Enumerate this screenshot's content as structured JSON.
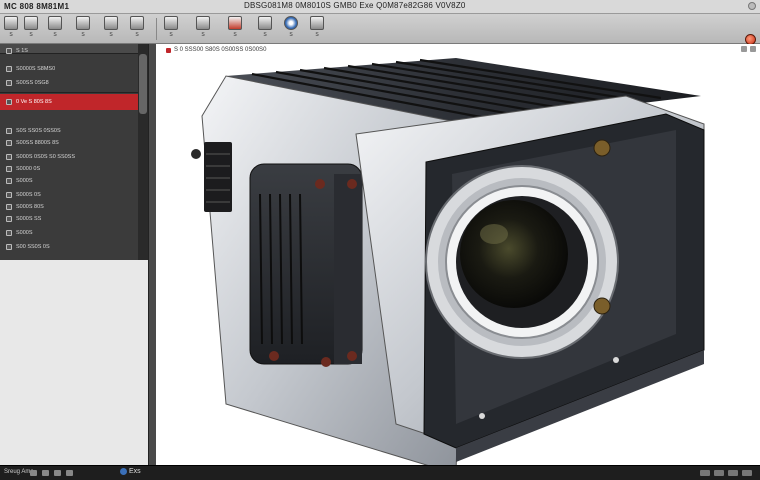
{
  "app": {
    "title": "MC 808 8M81M1",
    "document_title": "DBSG081M8 0M8010S  GMB0 Exe   Q0M87e82G86 V0V8Z0"
  },
  "ribbon": {
    "buttons": [
      {
        "label": "S",
        "icon": "tool-icon"
      },
      {
        "label": "S",
        "icon": "tool-icon"
      },
      {
        "label": "S",
        "icon": "tool-icon"
      },
      {
        "label": "S",
        "icon": "tool-icon"
      },
      {
        "label": "S",
        "icon": "tool-icon"
      },
      {
        "label": "S",
        "icon": "tool-icon"
      },
      {
        "label": "S",
        "icon": "tool-icon"
      },
      {
        "label": "S",
        "icon": "tool-icon"
      },
      {
        "label": "S",
        "icon": "tool-icon"
      },
      {
        "label": "S",
        "icon": "tool-icon"
      },
      {
        "label": "S",
        "icon": "tool-icon"
      },
      {
        "label": "S",
        "icon": "tool-icon"
      }
    ]
  },
  "tree": {
    "items": [
      {
        "label": "S 1S"
      },
      {
        "label": "S0000S S8MS0"
      },
      {
        "label": "S00SS 0SG8"
      },
      {
        "label": "0 Ve   S 80S 8S"
      },
      {
        "label": "S0S SS0S 0SS0S"
      },
      {
        "label": "S00SS 8800S 8S"
      },
      {
        "label": "S000S 0S0S S0 SS0SS"
      },
      {
        "label": "S0000 0S"
      },
      {
        "label": "S000S"
      },
      {
        "label": "S000S 0S"
      },
      {
        "label": "S000S 80S"
      },
      {
        "label": "S000S SS"
      },
      {
        "label": "S000S"
      },
      {
        "label": "S00 SS0S 0S"
      }
    ]
  },
  "viewport": {
    "tab_label": "S 0 SSS00 S80S 0S00SS 0S00S0"
  },
  "statusbar": {
    "left_text": "Sreug Ame",
    "mid_text": "Exs"
  },
  "colors": {
    "accent": "#c0262a",
    "panel_dark": "#3b3b3b",
    "viewport_bg": "#ffffff"
  }
}
